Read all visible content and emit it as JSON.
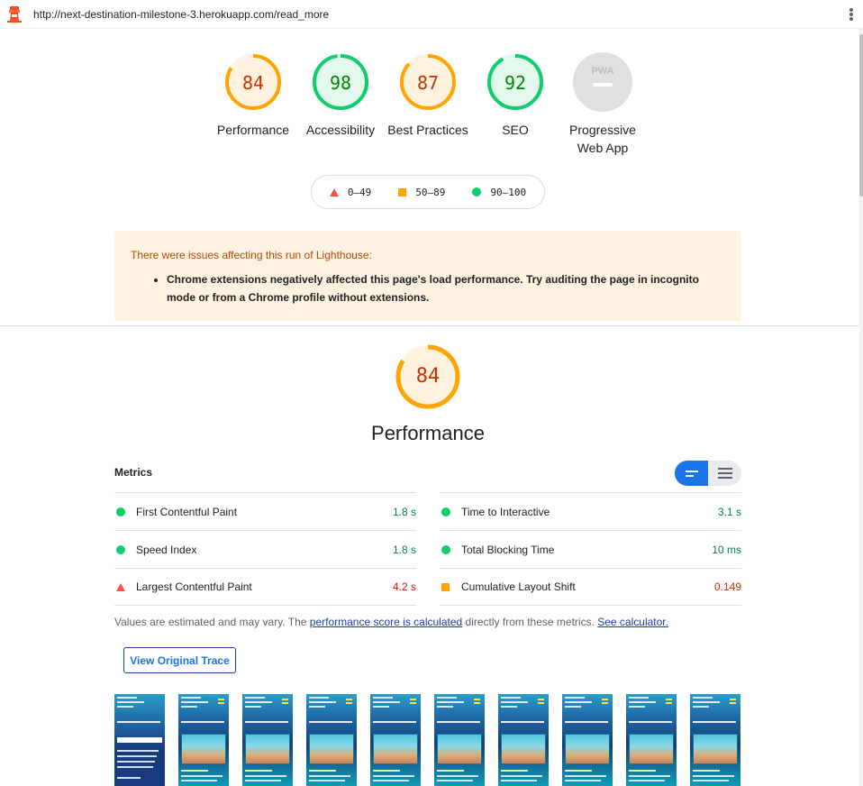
{
  "browser": {
    "url": "http://next-destination-milestone-3.herokuapp.com/read_more"
  },
  "colors": {
    "fail": "#ff4e42",
    "average": "#ffa400",
    "pass": "#0cce6b",
    "pwa_gray": "#e0e0e0"
  },
  "gauges": [
    {
      "score": "84",
      "label": "Performance",
      "rating": "average"
    },
    {
      "score": "98",
      "label": "Accessibility",
      "rating": "pass"
    },
    {
      "score": "87",
      "label": "Best Practices",
      "rating": "average"
    },
    {
      "score": "92",
      "label": "SEO",
      "rating": "pass"
    },
    {
      "score": "",
      "label": "Progressive Web App",
      "rating": "pwa",
      "badge": "PWA"
    }
  ],
  "legend": {
    "fail": "0–49",
    "average": "50–89",
    "pass": "90–100"
  },
  "warning": {
    "title": "There were issues affecting this run of Lighthouse:",
    "item": "Chrome extensions negatively affected this page's load performance. Try auditing the page in incognito mode or from a Chrome profile without extensions."
  },
  "performance": {
    "score": "84",
    "title": "Performance",
    "metrics_heading": "Metrics",
    "metrics": [
      {
        "name": "First Contentful Paint",
        "value": "1.8 s",
        "rating": "pass"
      },
      {
        "name": "Time to Interactive",
        "value": "3.1 s",
        "rating": "pass"
      },
      {
        "name": "Speed Index",
        "value": "1.8 s",
        "rating": "pass"
      },
      {
        "name": "Total Blocking Time",
        "value": "10 ms",
        "rating": "pass"
      },
      {
        "name": "Largest Contentful Paint",
        "value": "4.2 s",
        "rating": "fail"
      },
      {
        "name": "Cumulative Layout Shift",
        "value": "0.149",
        "rating": "average"
      }
    ],
    "note_prefix": "Values are estimated and may vary. The ",
    "note_link1": "performance score is calculated",
    "note_middle": " directly from these metrics. ",
    "note_link2": "See calculator.",
    "trace_button": "View Original Trace",
    "filmstrip_frames": 10
  }
}
